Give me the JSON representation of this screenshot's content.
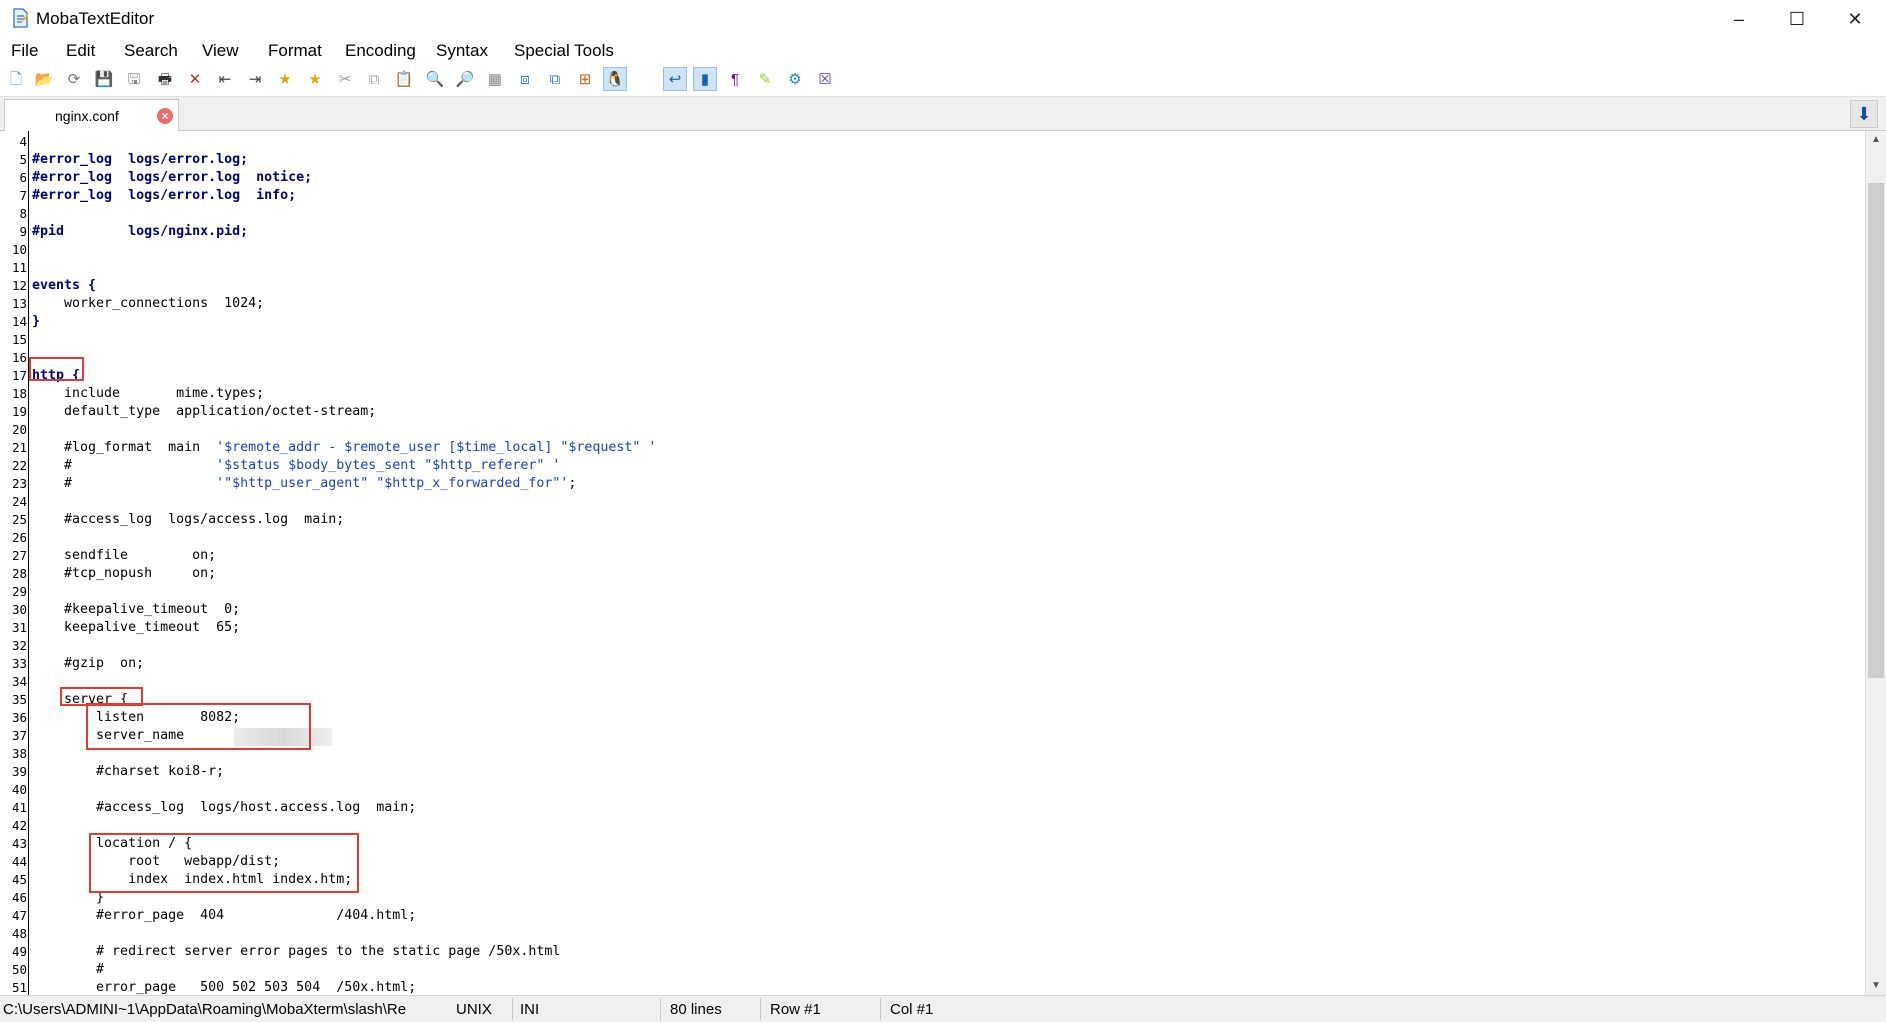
{
  "window": {
    "title": "MobaTextEditor",
    "minimize": "–",
    "maximize": "☐",
    "close": "✕"
  },
  "menu": [
    "File",
    "Edit",
    "Search",
    "View",
    "Format",
    "Encoding",
    "Syntax",
    "Special Tools"
  ],
  "toolbar": {
    "icons": [
      {
        "name": "new-file-icon",
        "glyph": "🗋",
        "color": "#4a90d9"
      },
      {
        "name": "open-folder-icon",
        "glyph": "📂",
        "color": "#e6a817"
      },
      {
        "name": "reload-icon",
        "glyph": "⟳",
        "color": "#777777"
      },
      {
        "name": "save-icon",
        "glyph": "💾",
        "color": "#777777"
      },
      {
        "name": "save-all-icon",
        "glyph": "🖫",
        "color": "#888888"
      },
      {
        "name": "print-icon",
        "glyph": "🖶",
        "color": "#333333"
      },
      {
        "name": "delete-icon",
        "glyph": "✕",
        "color": "#d62828"
      },
      {
        "name": "unindent-icon",
        "glyph": "⇤",
        "color": "#444444"
      },
      {
        "name": "indent-icon",
        "glyph": "⇥",
        "color": "#444444"
      },
      {
        "name": "bookmark-icon",
        "glyph": "★",
        "color": "#e0a800"
      },
      {
        "name": "bookmark-next-icon",
        "glyph": "★",
        "color": "#e0a800"
      },
      {
        "name": "cut-icon",
        "glyph": "✂",
        "color": "#999999"
      },
      {
        "name": "copy-icon",
        "glyph": "⧉",
        "color": "#aaaaaa"
      },
      {
        "name": "paste-icon",
        "glyph": "📋",
        "color": "#aaaaaa"
      },
      {
        "name": "find-icon",
        "glyph": "🔍",
        "color": "#1e5fb3"
      },
      {
        "name": "find-replace-icon",
        "glyph": "🔎",
        "color": "#1e90d9"
      },
      {
        "name": "goto-icon",
        "glyph": "▦",
        "color": "#888888"
      },
      {
        "name": "compare-icon",
        "glyph": "⧈",
        "color": "#3a7bd5"
      },
      {
        "name": "sync-icon",
        "glyph": "⧉",
        "color": "#3a7bd5"
      },
      {
        "name": "windows-eol-icon",
        "glyph": "⊞",
        "color": "#e0601a"
      },
      {
        "name": "linux-eol-icon",
        "glyph": "🐧",
        "color": "#222222"
      },
      {
        "name": "mac-eol-icon",
        "glyph": "",
        "color": "#1e88e5"
      },
      {
        "name": "word-wrap-icon",
        "glyph": "↩",
        "color": "#1e5fb3"
      },
      {
        "name": "column-mode-icon",
        "glyph": "▮",
        "color": "#1e5fb3"
      },
      {
        "name": "show-symbols-icon",
        "glyph": "¶",
        "color": "#6a1b9a"
      },
      {
        "name": "highlight-icon",
        "glyph": "✎",
        "color": "#9acd32"
      },
      {
        "name": "settings-icon",
        "glyph": "⚙",
        "color": "#1e88e5"
      },
      {
        "name": "close-all-icon",
        "glyph": "☒",
        "color": "#5b3fd6"
      }
    ]
  },
  "tabs": [
    {
      "label": "nginx.conf",
      "close": "×"
    }
  ],
  "tab_scroll_icon": "⬇",
  "editor": {
    "lines": [
      {
        "n": "4",
        "text": "",
        "style": "kw"
      },
      {
        "n": "5",
        "text": "#error_log  logs/error.log;",
        "style": "kw"
      },
      {
        "n": "6",
        "text": "#error_log  logs/error.log  notice;",
        "style": "kw"
      },
      {
        "n": "7",
        "text": "#error_log  logs/error.log  info;",
        "style": "kw"
      },
      {
        "n": "8",
        "text": "",
        "style": "plain"
      },
      {
        "n": "9",
        "text": "#pid        logs/nginx.pid;",
        "style": "kw"
      },
      {
        "n": "10",
        "text": "",
        "style": "plain"
      },
      {
        "n": "11",
        "text": "",
        "style": "plain"
      },
      {
        "n": "12",
        "text": "events {",
        "style": "kw"
      },
      {
        "n": "13",
        "text": "    worker_connections  1024;",
        "style": "plain"
      },
      {
        "n": "14",
        "text": "}",
        "style": "kw"
      },
      {
        "n": "15",
        "text": "",
        "style": "plain"
      },
      {
        "n": "16",
        "text": "",
        "style": "plain"
      },
      {
        "n": "17",
        "text": "http {",
        "style": "kw"
      },
      {
        "n": "18",
        "text": "    include       mime.types;",
        "style": "plain"
      },
      {
        "n": "19",
        "text": "    default_type  application/octet-stream;",
        "style": "plain"
      },
      {
        "n": "20",
        "text": "",
        "style": "plain"
      },
      {
        "n": "21",
        "text": "    #log_format  main  ",
        "style": "plain",
        "str": "'$remote_addr - $remote_user [$time_local] \"$request\" '"
      },
      {
        "n": "22",
        "text": "    #                  ",
        "style": "plain",
        "str": "'$status $body_bytes_sent \"$http_referer\" '"
      },
      {
        "n": "23",
        "text": "    #                  ",
        "style": "plain",
        "str": "'\"$http_user_agent\" \"$http_x_forwarded_for\"'",
        "tail": ";"
      },
      {
        "n": "24",
        "text": "",
        "style": "plain"
      },
      {
        "n": "25",
        "text": "    #access_log  logs/access.log  main;",
        "style": "plain"
      },
      {
        "n": "26",
        "text": "",
        "style": "plain"
      },
      {
        "n": "27",
        "text": "    sendfile        on;",
        "style": "plain"
      },
      {
        "n": "28",
        "text": "    #tcp_nopush     on;",
        "style": "plain"
      },
      {
        "n": "29",
        "text": "",
        "style": "plain"
      },
      {
        "n": "30",
        "text": "    #keepalive_timeout  0;",
        "style": "plain"
      },
      {
        "n": "31",
        "text": "    keepalive_timeout  65;",
        "style": "plain"
      },
      {
        "n": "32",
        "text": "",
        "style": "plain"
      },
      {
        "n": "33",
        "text": "    #gzip  on;",
        "style": "plain"
      },
      {
        "n": "34",
        "text": "",
        "style": "plain"
      },
      {
        "n": "35",
        "text": "    server {",
        "style": "plain"
      },
      {
        "n": "36",
        "text": "        listen       8082;",
        "style": "plain"
      },
      {
        "n": "37",
        "text": "        server_name  ",
        "style": "plain",
        "blurred": true
      },
      {
        "n": "38",
        "text": "",
        "style": "plain"
      },
      {
        "n": "39",
        "text": "        #charset koi8-r;",
        "style": "plain"
      },
      {
        "n": "40",
        "text": "",
        "style": "plain"
      },
      {
        "n": "41",
        "text": "        #access_log  logs/host.access.log  main;",
        "style": "plain"
      },
      {
        "n": "42",
        "text": "",
        "style": "plain"
      },
      {
        "n": "43",
        "text": "        location / {",
        "style": "plain"
      },
      {
        "n": "44",
        "text": "            root   webapp/dist;",
        "style": "plain"
      },
      {
        "n": "45",
        "text": "            index  index.html index.htm;",
        "style": "plain"
      },
      {
        "n": "46",
        "text": "        }",
        "style": "plain"
      },
      {
        "n": "47",
        "text": "        #error_page  404              /404.html;",
        "style": "plain"
      },
      {
        "n": "48",
        "text": "",
        "style": "plain"
      },
      {
        "n": "49",
        "text": "        # redirect server error pages to the static page /50x.html",
        "style": "plain"
      },
      {
        "n": "50",
        "text": "        #",
        "style": "plain"
      },
      {
        "n": "51",
        "text": "        error_page   500 502 503 504  /50x.html;",
        "style": "plain"
      }
    ]
  },
  "status": {
    "path": "C:\\Users\\ADMINI~1\\AppData\\Roaming\\MobaXterm\\slash\\Re",
    "eol": "UNIX",
    "syntax": "INI",
    "lines": "80 lines",
    "row": "Row #1",
    "col": "Col #1"
  },
  "colors": {
    "keyword": "#000080",
    "string": "#1a3fcc",
    "annotation_box": "#e53935"
  }
}
